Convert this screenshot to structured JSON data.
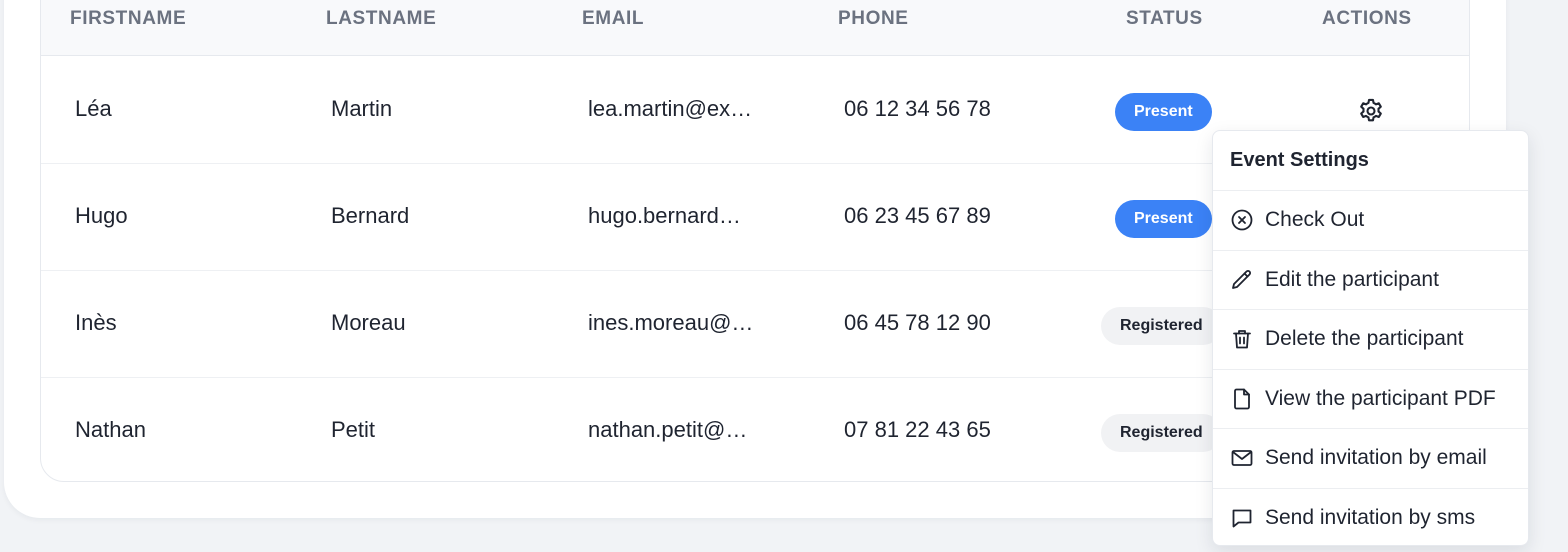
{
  "table": {
    "columns": [
      "FIRSTNAME",
      "LASTNAME",
      "EMAIL",
      "PHONE",
      "STATUS",
      "ACTIONS"
    ],
    "rows": [
      {
        "firstname": "Léa",
        "lastname": "Martin",
        "email": "lea.martin@ex…",
        "phone": "06 12 34 56 78",
        "status": "Present"
      },
      {
        "firstname": "Hugo",
        "lastname": "Bernard",
        "email": "hugo.bernard…",
        "phone": "06 23 45 67 89",
        "status": "Present"
      },
      {
        "firstname": "Inès",
        "lastname": "Moreau",
        "email": "ines.moreau@…",
        "phone": "06 45 78 12 90",
        "status": "Registered"
      },
      {
        "firstname": "Nathan",
        "lastname": "Petit",
        "email": "nathan.petit@…",
        "phone": "07 81 22 43 65",
        "status": "Registered"
      }
    ]
  },
  "menu": {
    "title": "Event Settings",
    "items": [
      {
        "label": "Check Out",
        "icon": "x-circle-icon"
      },
      {
        "label": "Edit the participant",
        "icon": "pencil-icon"
      },
      {
        "label": "Delete the participant",
        "icon": "trash-icon"
      },
      {
        "label": "View the participant PDF",
        "icon": "file-icon"
      },
      {
        "label": "Send invitation by email",
        "icon": "mail-icon"
      },
      {
        "label": "Send invitation by sms",
        "icon": "message-icon"
      }
    ]
  },
  "colors": {
    "present_badge": "#3b82f6",
    "registered_badge": "#f1f2f4",
    "page_background": "#f1f3f6"
  }
}
